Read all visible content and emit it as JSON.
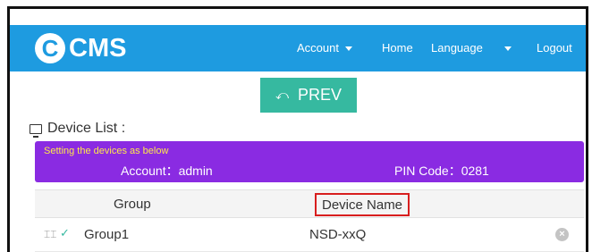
{
  "navbar": {
    "logo_text": "CMS",
    "logo_letter": "C",
    "account": "Account",
    "home": "Home",
    "language": "Language",
    "logout": "Logout"
  },
  "prev_button": {
    "icon": "undo-arrow-icon",
    "label": "PREV"
  },
  "device_list": {
    "icon": "monitor-icon",
    "title": "Device List :"
  },
  "banner": {
    "note": "Setting the devices as below",
    "account": "Account：admin",
    "pin": "PIN Code：0281",
    "color": "#8a2be2"
  },
  "table": {
    "headers": {
      "group": "Group",
      "device_name": "Device Name"
    },
    "rows": [
      {
        "group": "Group1",
        "device": "NSD-xxQ"
      }
    ]
  },
  "colors": {
    "nav": "#1e9be0",
    "accent": "#36b9a0",
    "highlight": "#d81e1e"
  }
}
